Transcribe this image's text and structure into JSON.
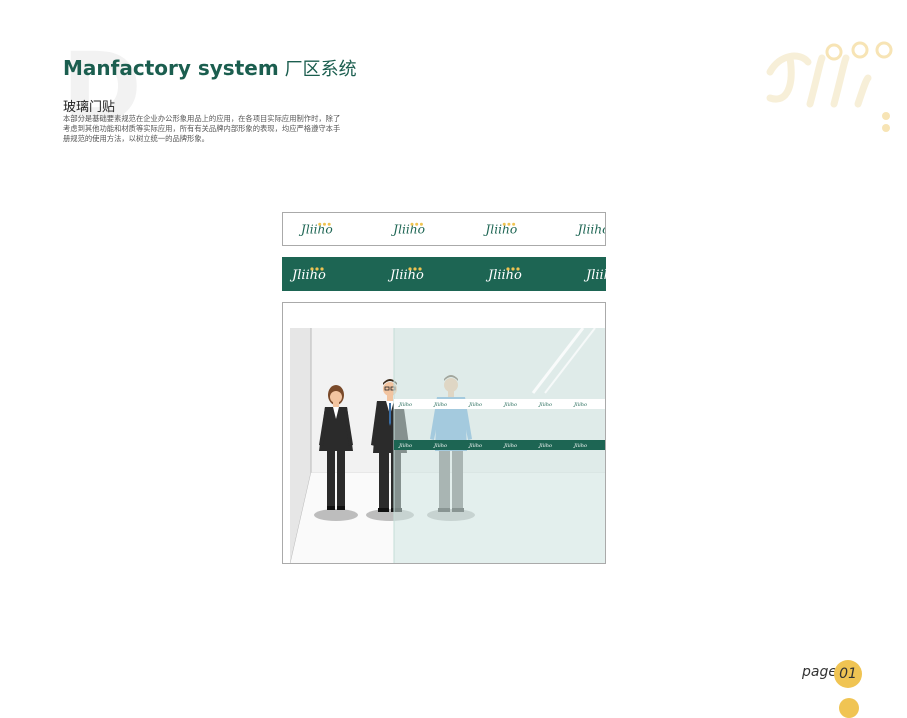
{
  "header": {
    "title_en": "Manfactory system",
    "title_cn": "厂区系统",
    "watermark_letter": "D"
  },
  "section": {
    "title": "玻璃门贴",
    "description": "本部分是基础要素规范在企业办公形象用品上的应用，在各项目实际应用制作时，除了考虑到其他功能和材质等实际应用，所有有关品牌内部形象的表现，均应严格遵守本手册规范的使用方法，以树立统一的品牌形象。"
  },
  "brand": {
    "logo_text": "Jliiho",
    "primary_color": "#1d6553",
    "accent_color": "#f0c453"
  },
  "footer": {
    "page_label": "page",
    "page_number": "01"
  }
}
